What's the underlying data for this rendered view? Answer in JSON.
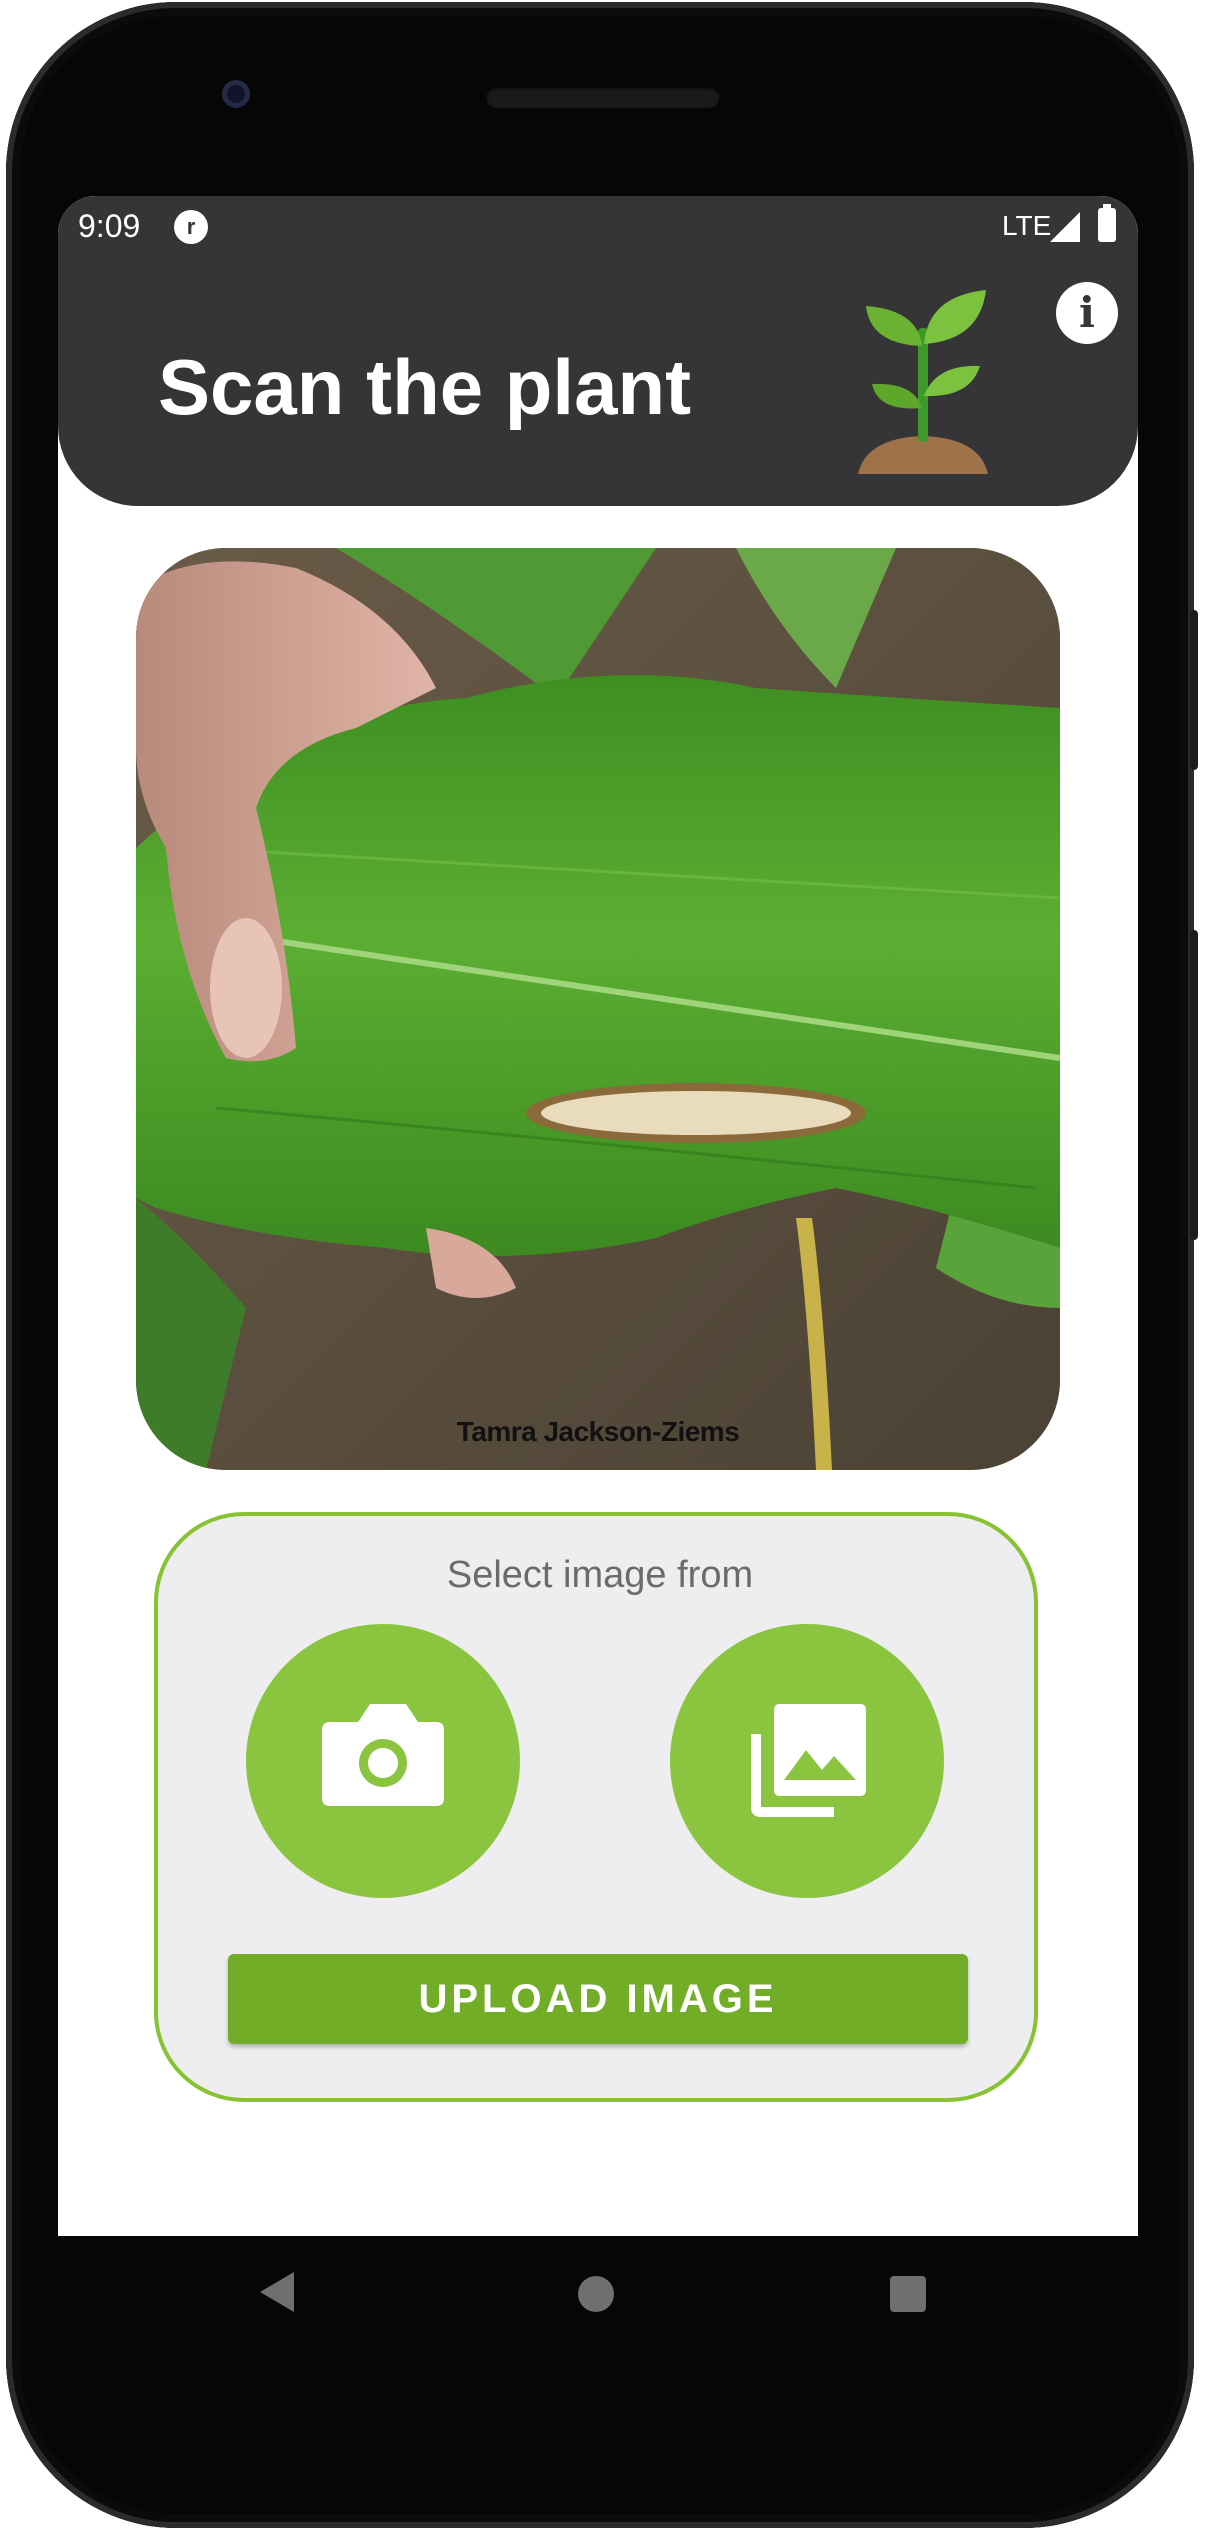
{
  "status_bar": {
    "time": "9:09",
    "app_icon": "r",
    "network": "LTE",
    "icons": [
      "signal-icon",
      "battery-icon"
    ]
  },
  "header": {
    "title": "Scan the plant",
    "info_label": "i",
    "logo_icon": "sprout-icon"
  },
  "photo": {
    "credit": "Tamra Jackson-Ziems"
  },
  "selector": {
    "label": "Select image from",
    "camera_icon": "camera-icon",
    "gallery_icon": "gallery-icon",
    "upload_label": "UPLOAD IMAGE"
  },
  "navigation": {
    "icons": [
      "back-icon",
      "home-icon",
      "recents-icon"
    ]
  },
  "colors": {
    "header": "#353537",
    "accent": "#8bc540",
    "button": "#71ad26",
    "card_background": "#eeeef0"
  }
}
